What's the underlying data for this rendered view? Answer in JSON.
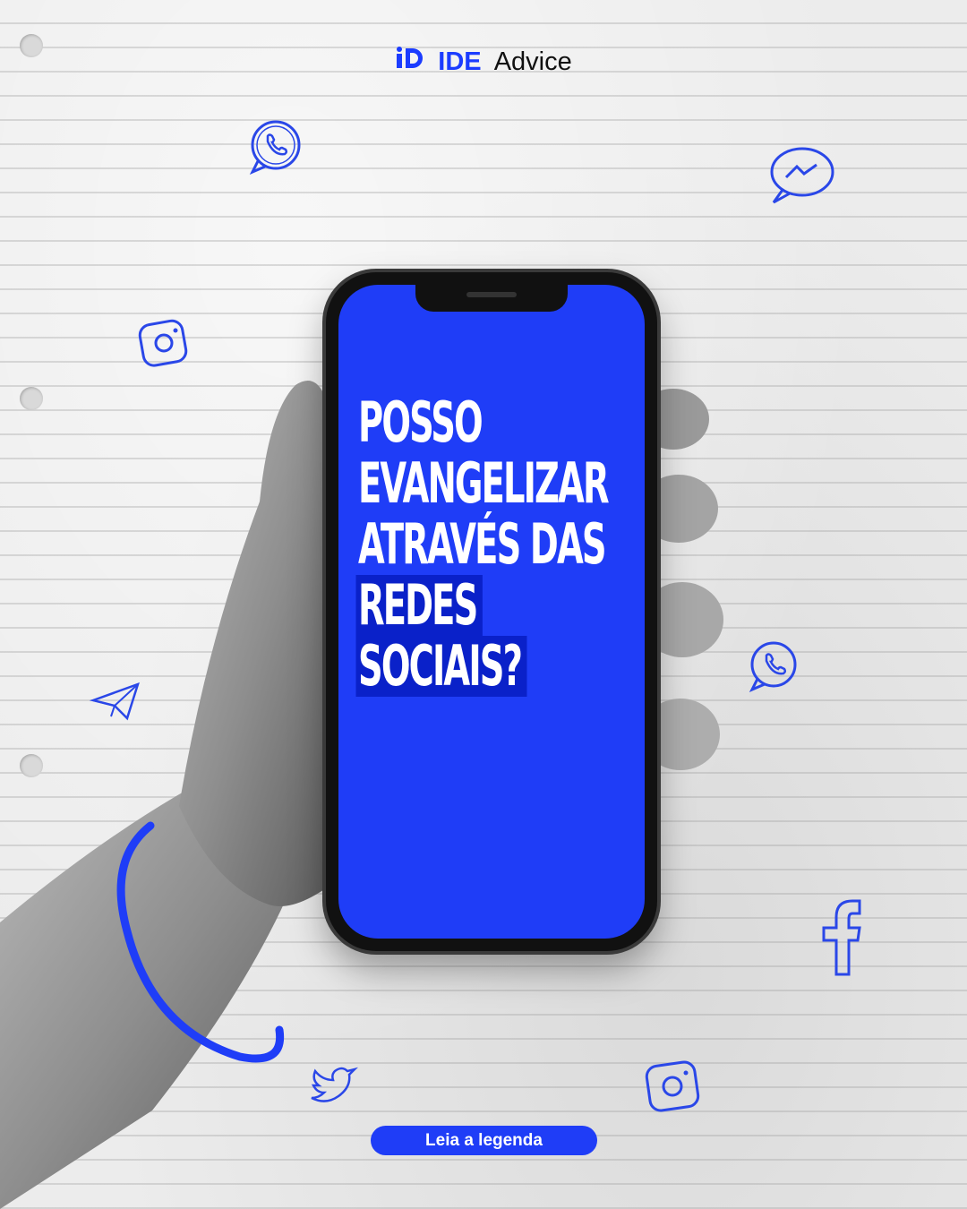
{
  "logo": {
    "brand": "IDE",
    "suffix": "Advice"
  },
  "headline": {
    "line1": "POSSO",
    "line2": "EVANGELIZAR",
    "line3": "ATRAVÉS DAS",
    "line4": "REDES",
    "line5": "SOCIAIS?"
  },
  "cta": {
    "label": "Leia a legenda"
  },
  "colors": {
    "accent": "#1f3df7",
    "highlight": "#0a21c9",
    "paper": "#ececec"
  },
  "icons": [
    "whatsapp-icon",
    "messenger-icon",
    "instagram-icon",
    "telegram-icon",
    "facebook-icon",
    "twitter-icon"
  ]
}
